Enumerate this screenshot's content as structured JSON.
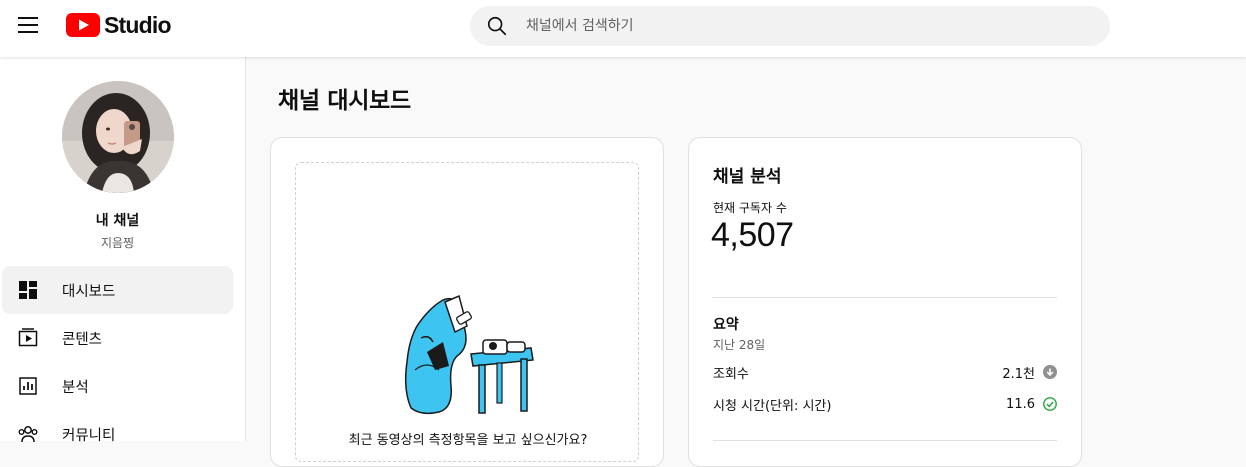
{
  "header": {
    "logo_text": "Studio",
    "search_placeholder": "채널에서 검색하기"
  },
  "sidebar": {
    "channel_name": "내 채널",
    "channel_handle": "지음찡",
    "items": [
      {
        "label": "대시보드",
        "icon": "dashboard-icon",
        "active": true
      },
      {
        "label": "콘텐츠",
        "icon": "content-icon",
        "active": false
      },
      {
        "label": "분석",
        "icon": "analytics-icon",
        "active": false
      },
      {
        "label": "커뮤니티",
        "icon": "community-icon",
        "active": false
      }
    ]
  },
  "main": {
    "page_title": "채널 대시보드",
    "upload_card": {
      "prompt": "최근 동영상의 측정항목을 보고 싶으신가요?"
    },
    "analytics_card": {
      "title": "채널 분석",
      "subscribers_label": "현재 구독자 수",
      "subscribers_value": "4,507",
      "summary_title": "요약",
      "summary_period": "지난 28일",
      "metrics": [
        {
          "label": "조회수",
          "value": "2.1천",
          "trend_icon": "arrow-down-circle-icon",
          "color": "#909090"
        },
        {
          "label": "시청 시간(단위: 시간)",
          "value": "11.6",
          "trend_icon": "check-circle-icon",
          "color": "#2ba640"
        }
      ]
    }
  },
  "colors": {
    "brand_red": "#ff0000",
    "illustration_blue": "#3ec4f0"
  }
}
